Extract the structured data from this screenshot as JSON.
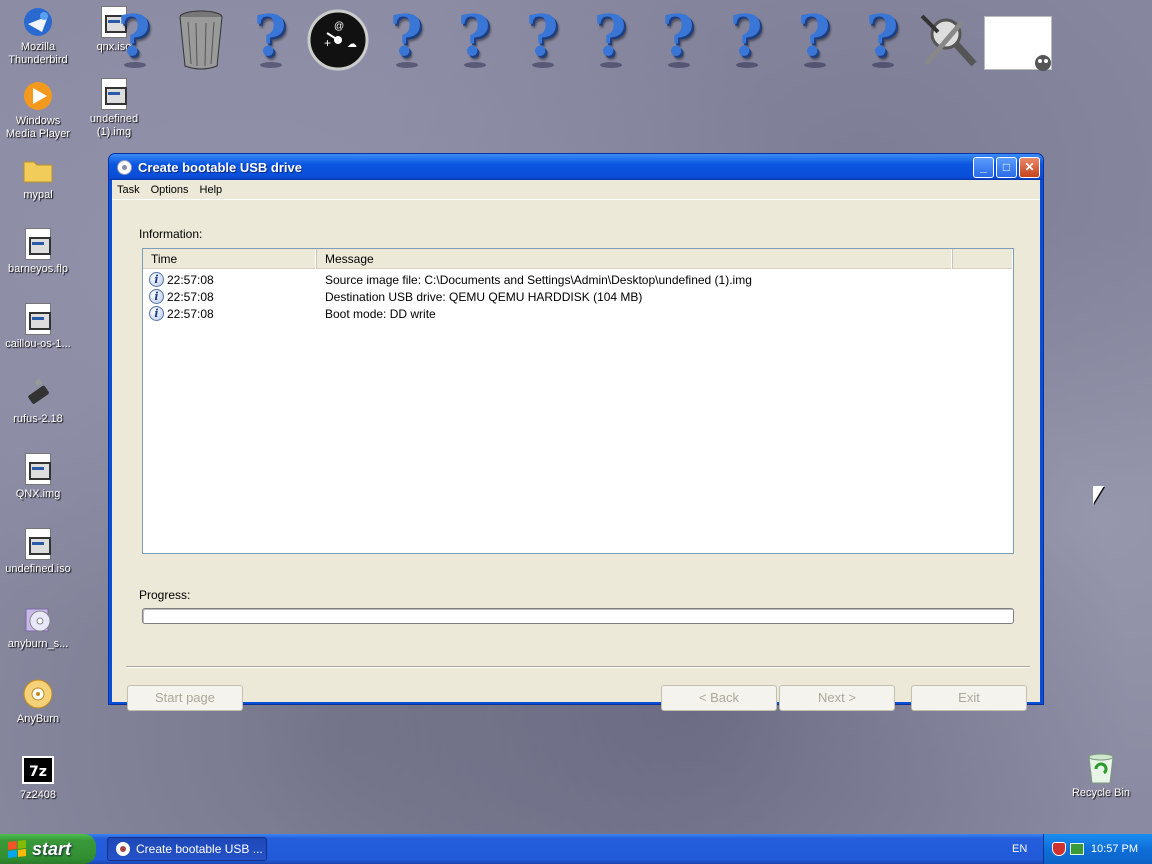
{
  "desktop": {
    "left_icons": [
      {
        "label": "Mozilla Thunderbird",
        "icon": "thunderbird-icon"
      },
      {
        "label": "Windows Media Player",
        "icon": "media-player-icon"
      },
      {
        "label": "mypal",
        "icon": "folder-icon"
      },
      {
        "label": "barneyos.flp",
        "icon": "image-file-icon"
      },
      {
        "label": "caillou-os-1...",
        "icon": "image-file-icon"
      },
      {
        "label": "rufus-2.18",
        "icon": "usb-drive-icon"
      },
      {
        "label": "QNX.img",
        "icon": "image-file-icon"
      },
      {
        "label": "undefined.iso",
        "icon": "image-file-icon"
      },
      {
        "label": "anyburn_s...",
        "icon": "anyburn-setup-icon"
      },
      {
        "label": "AnyBurn",
        "icon": "anyburn-icon"
      },
      {
        "label": "7z2408",
        "icon": "7zip-icon"
      }
    ],
    "second_column": [
      {
        "label": "qnx.iso",
        "icon": "image-file-icon"
      },
      {
        "label": "undefined (1).img",
        "icon": "image-file-icon"
      }
    ],
    "recycle_bin": {
      "label": "Recycle Bin",
      "icon": "recycle-bin-icon"
    }
  },
  "window": {
    "title": "Create bootable USB drive",
    "menu": [
      "Task",
      "Options",
      "Help"
    ],
    "information_label": "Information:",
    "columns": [
      "Time",
      "Message"
    ],
    "log": [
      {
        "time": "22:57:08",
        "message": "Source image file: C:\\Documents and Settings\\Admin\\Desktop\\undefined (1).img"
      },
      {
        "time": "22:57:08",
        "message": "Destination USB drive: QEMU QEMU HARDDISK (104 MB)"
      },
      {
        "time": "22:57:08",
        "message": "Boot mode: DD write"
      }
    ],
    "progress_label": "Progress:",
    "progress_value": 0,
    "buttons": {
      "start_page": "Start page",
      "back": "< Back",
      "next": "Next >",
      "exit": "Exit"
    }
  },
  "taskbar": {
    "start_label": "start",
    "task_label": "Create bootable USB ...",
    "language": "EN",
    "clock": "10:57 PM"
  },
  "colors": {
    "titlebar": "#0a4ed8",
    "taskbar": "#245edc",
    "start_button": "#3a9a3a",
    "dialog_bg": "#ece9d8"
  }
}
